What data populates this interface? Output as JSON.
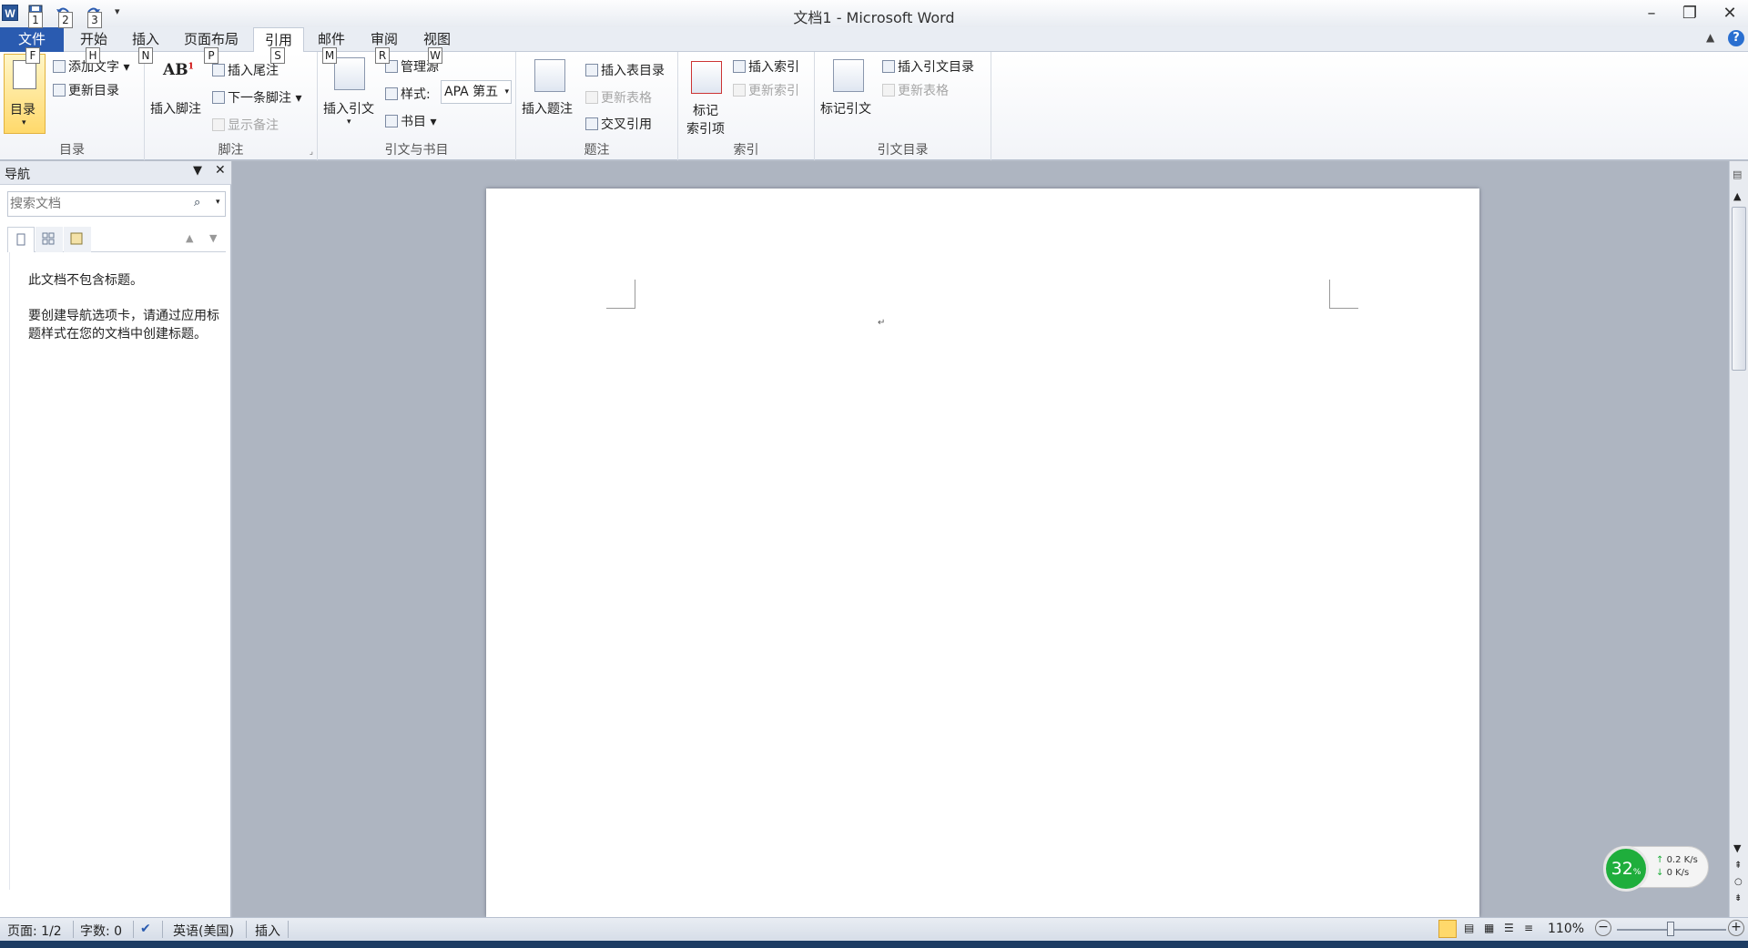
{
  "window": {
    "title": "文档1 - Microsoft Word",
    "app_icon": "W"
  },
  "quick_access": [
    "1",
    "2",
    "3"
  ],
  "tabs": {
    "file": "文件",
    "home": "开始",
    "insert": "插入",
    "layout": "页面布局",
    "references": "引用",
    "mailings": "邮件",
    "review": "审阅",
    "view": "视图"
  },
  "keytips": {
    "file": "F",
    "home": "H",
    "insert": "N",
    "layout": "P",
    "references": "S",
    "mailings": "M",
    "review": "R",
    "view": "W"
  },
  "ribbon": {
    "toc": {
      "group": "目录",
      "big_button": "目录",
      "add_text": "添加文字",
      "update": "更新目录"
    },
    "footnotes": {
      "group": "脚注",
      "insert_footnote": "插入脚注",
      "insert_endnote": "插入尾注",
      "next_footnote": "下一条脚注",
      "show_notes": "显示备注"
    },
    "citations": {
      "group": "引文与书目",
      "insert_citation": "插入引文",
      "manage_sources": "管理源",
      "style_label": "样式:",
      "style_value": "APA 第五",
      "bibliography": "书目"
    },
    "captions": {
      "group": "题注",
      "insert_caption": "插入题注",
      "insert_table_of_figures": "插入表目录",
      "update_table": "更新表格",
      "cross_reference": "交叉引用"
    },
    "index": {
      "group": "索引",
      "mark_entry_line1": "标记",
      "mark_entry_line2": "索引项",
      "insert_index": "插入索引",
      "update_index": "更新索引"
    },
    "toa": {
      "group": "引文目录",
      "mark_citation": "标记引文",
      "insert_toa": "插入引文目录",
      "update_table": "更新表格"
    }
  },
  "nav_pane": {
    "title": "导航",
    "search_placeholder": "搜索文档",
    "message1": "此文档不包含标题。",
    "message2": "要创建导航选项卡，请通过应用标题样式在您的文档中创建标题。"
  },
  "document": {
    "paragraph_mark": "↵"
  },
  "status": {
    "page": "页面: 1/2",
    "words": "字数: 0",
    "language": "英语(美国)",
    "mode": "插入",
    "zoom": "110%"
  },
  "net_widget": {
    "percent": "32",
    "percent_sign": "%",
    "up": "0.2 K/s",
    "down": "0 K/s"
  },
  "colors": {
    "file_tab": "#2a5bb0",
    "canvas": "#aeb5c1",
    "widget_green": "#1fae3c"
  }
}
